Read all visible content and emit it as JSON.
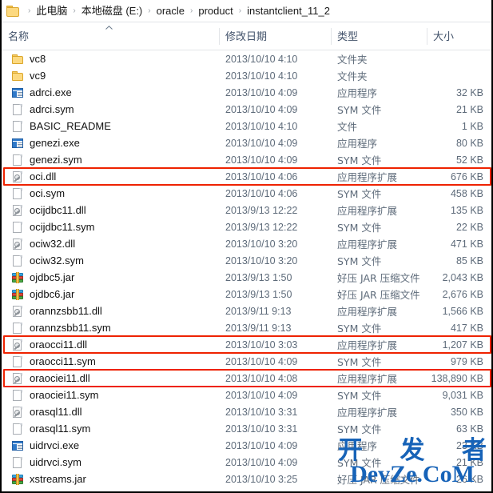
{
  "breadcrumb": {
    "folder_icon": "folder-icon",
    "separator": "›",
    "segments": [
      {
        "label": "此电脑"
      },
      {
        "label": "本地磁盘 (E:)"
      },
      {
        "label": "oracle"
      },
      {
        "label": "product"
      },
      {
        "label": "instantclient_11_2"
      }
    ]
  },
  "columns": {
    "name": "名称",
    "date_modified": "修改日期",
    "type": "类型",
    "size": "大小",
    "sort_indicator": "caret-up-icon"
  },
  "highlight_color": "#ee2200",
  "rows": [
    {
      "icon": "folder",
      "name": "vc8",
      "date": "2013/10/10 4:10",
      "type": "文件夹",
      "size": "",
      "highlighted": false
    },
    {
      "icon": "folder",
      "name": "vc9",
      "date": "2013/10/10 4:10",
      "type": "文件夹",
      "size": "",
      "highlighted": false
    },
    {
      "icon": "exe",
      "name": "adrci.exe",
      "date": "2013/10/10 4:09",
      "type": "应用程序",
      "size": "32 KB",
      "highlighted": false
    },
    {
      "icon": "file",
      "name": "adrci.sym",
      "date": "2013/10/10 4:09",
      "type": "SYM 文件",
      "size": "21 KB",
      "highlighted": false
    },
    {
      "icon": "file",
      "name": "BASIC_README",
      "date": "2013/10/10 4:10",
      "type": "文件",
      "size": "1 KB",
      "highlighted": false
    },
    {
      "icon": "exe",
      "name": "genezi.exe",
      "date": "2013/10/10 4:09",
      "type": "应用程序",
      "size": "80 KB",
      "highlighted": false
    },
    {
      "icon": "file",
      "name": "genezi.sym",
      "date": "2013/10/10 4:09",
      "type": "SYM 文件",
      "size": "52 KB",
      "highlighted": false
    },
    {
      "icon": "dll",
      "name": "oci.dll",
      "date": "2013/10/10 4:06",
      "type": "应用程序扩展",
      "size": "676 KB",
      "highlighted": true
    },
    {
      "icon": "file",
      "name": "oci.sym",
      "date": "2013/10/10 4:06",
      "type": "SYM 文件",
      "size": "458 KB",
      "highlighted": false
    },
    {
      "icon": "dll",
      "name": "ocijdbc11.dll",
      "date": "2013/9/13 12:22",
      "type": "应用程序扩展",
      "size": "135 KB",
      "highlighted": false
    },
    {
      "icon": "file",
      "name": "ocijdbc11.sym",
      "date": "2013/9/13 12:22",
      "type": "SYM 文件",
      "size": "22 KB",
      "highlighted": false
    },
    {
      "icon": "dll",
      "name": "ociw32.dll",
      "date": "2013/10/10 3:20",
      "type": "应用程序扩展",
      "size": "471 KB",
      "highlighted": false
    },
    {
      "icon": "file",
      "name": "ociw32.sym",
      "date": "2013/10/10 3:20",
      "type": "SYM 文件",
      "size": "85 KB",
      "highlighted": false
    },
    {
      "icon": "jar",
      "name": "ojdbc5.jar",
      "date": "2013/9/13 1:50",
      "type": "好压 JAR 压缩文件",
      "size": "2,043 KB",
      "highlighted": false
    },
    {
      "icon": "jar",
      "name": "ojdbc6.jar",
      "date": "2013/9/13 1:50",
      "type": "好压 JAR 压缩文件",
      "size": "2,676 KB",
      "highlighted": false
    },
    {
      "icon": "dll",
      "name": "orannzsbb11.dll",
      "date": "2013/9/11 9:13",
      "type": "应用程序扩展",
      "size": "1,566 KB",
      "highlighted": false
    },
    {
      "icon": "file",
      "name": "orannzsbb11.sym",
      "date": "2013/9/11 9:13",
      "type": "SYM 文件",
      "size": "417 KB",
      "highlighted": false
    },
    {
      "icon": "dll",
      "name": "oraocci11.dll",
      "date": "2013/10/10 3:03",
      "type": "应用程序扩展",
      "size": "1,207 KB",
      "highlighted": true
    },
    {
      "icon": "file",
      "name": "oraocci11.sym",
      "date": "2013/10/10 4:09",
      "type": "SYM 文件",
      "size": "979 KB",
      "highlighted": false
    },
    {
      "icon": "dll",
      "name": "oraociei11.dll",
      "date": "2013/10/10 4:08",
      "type": "应用程序扩展",
      "size": "138,890 KB",
      "highlighted": true
    },
    {
      "icon": "file",
      "name": "oraociei11.sym",
      "date": "2013/10/10 4:09",
      "type": "SYM 文件",
      "size": "9,031 KB",
      "highlighted": false
    },
    {
      "icon": "dll",
      "name": "orasql11.dll",
      "date": "2013/10/10 3:31",
      "type": "应用程序扩展",
      "size": "350 KB",
      "highlighted": false
    },
    {
      "icon": "file",
      "name": "orasql11.sym",
      "date": "2013/10/10 3:31",
      "type": "SYM 文件",
      "size": "63 KB",
      "highlighted": false
    },
    {
      "icon": "exe",
      "name": "uidrvci.exe",
      "date": "2013/10/10 4:09",
      "type": "应用程序",
      "size": "23 KB",
      "highlighted": false
    },
    {
      "icon": "file",
      "name": "uidrvci.sym",
      "date": "2013/10/10 4:09",
      "type": "SYM 文件",
      "size": "21 KB",
      "highlighted": false
    },
    {
      "icon": "jar",
      "name": "xstreams.jar",
      "date": "2013/10/10 3:25",
      "type": "好压 JAR 压缩文件",
      "size": "26 KB",
      "highlighted": false
    }
  ],
  "watermark": {
    "char1": "开",
    "char2": "发",
    "char3": "者",
    "site": "DevZe.CoM",
    "color": "#1763b8"
  }
}
